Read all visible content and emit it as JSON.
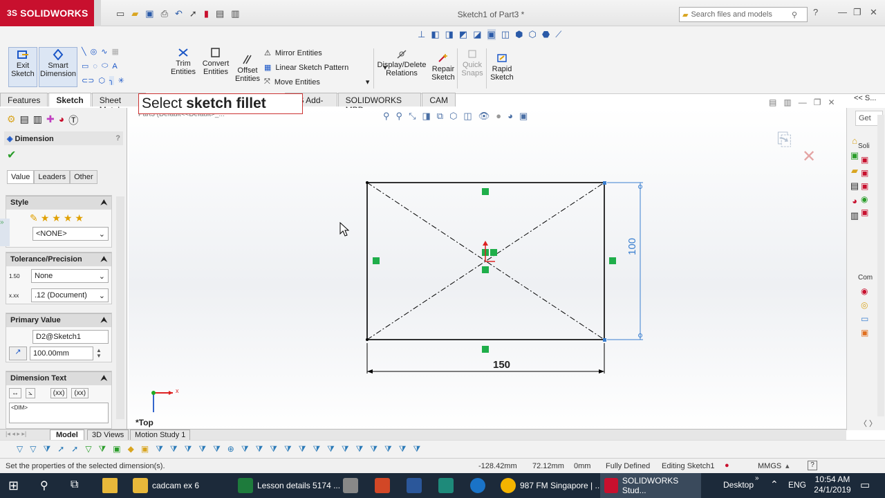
{
  "app": {
    "brand": "SOLIDWORKS",
    "brand_prefix": "3S",
    "document_title": "Sketch1 of Part3 *",
    "search_placeholder": "Search files and models"
  },
  "commands": {
    "exit_sketch": "Exit Sketch",
    "smart_dimension": "Smart Dimension",
    "trim_entities": "Trim Entities",
    "convert_entities": "Convert Entities",
    "offset_entities": "Offset Entities",
    "mirror_entities": "Mirror Entities",
    "linear_sketch_pattern": "Linear Sketch Pattern",
    "move_entities": "Move Entities",
    "display_delete_relations": "Display/Delete Relations",
    "repair_sketch": "Repair Sketch",
    "quick_snaps": "Quick Snaps",
    "rapid_sketch": "Rapid Sketch"
  },
  "tabs": [
    "Features",
    "Sketch",
    "Sheet Metal",
    "KS Add-Ins",
    "SOLIDWORKS MBD",
    "CAM"
  ],
  "active_tab": "Sketch",
  "tooltip": {
    "prefix": "Select ",
    "bold": "sketch fillet"
  },
  "tree_path": "Part3 (Default<<Default>_...",
  "property_manager": {
    "title": "Dimension",
    "help": "?",
    "subtabs": [
      "Value",
      "Leaders",
      "Other"
    ],
    "style": {
      "header": "Style",
      "selected": "<NONE>"
    },
    "tolerance": {
      "header": "Tolerance/Precision",
      "tolerance_value": "None",
      "precision_value": ".12 (Document)",
      "tol_icon_label": "1.50",
      "prec_icon_label": "x.xx"
    },
    "primary_value": {
      "header": "Primary Value",
      "name": "D2@Sketch1",
      "value": "100.00mm"
    },
    "dimension_text": {
      "header": "Dimension Text",
      "text": "<DIM>",
      "btn1": "(xx)",
      "btn2": "(xx)"
    }
  },
  "sketch": {
    "width_dimension": "150",
    "height_dimension": "100",
    "view_label": "*Top",
    "axis_x": "x",
    "axis_y": "y"
  },
  "right_panel": {
    "get": "Get",
    "sol": "Soli",
    "com": "Com",
    "header": "<< S..."
  },
  "bottom_tabs": [
    "Model",
    "3D Views",
    "Motion Study 1"
  ],
  "active_bottom_tab": "Model",
  "status": {
    "message": "Set the properties of the selected dimension(s).",
    "x": "-128.42mm",
    "y": "72.12mm",
    "z": "0mm",
    "state": "Fully Defined",
    "editing": "Editing Sketch1",
    "units": "MMGS"
  },
  "taskbar": {
    "items": [
      {
        "label": "cadcam ex 6",
        "color": "#e8b83a"
      },
      {
        "label": "Lesson details 5174 ...",
        "color": "#1e7b3c"
      },
      {
        "label": "",
        "color": "#888888"
      },
      {
        "label": "",
        "color": "#d24726"
      },
      {
        "label": "",
        "color": "#2b579a"
      },
      {
        "label": "",
        "color": "#1e8a7a"
      },
      {
        "label": "",
        "color": "#1a73c7"
      },
      {
        "label": "987 FM Singapore | ...",
        "color": "#f4b400"
      },
      {
        "label": "SOLIDWORKS Stud...",
        "color": "#c8102e"
      }
    ],
    "desktop": "Desktop",
    "lang": "ENG",
    "time": "10:54 AM",
    "date": "24/1/2019"
  },
  "colors": {
    "brand_red": "#c8102e",
    "dimension_blue": "#3a7fd0",
    "relation_green": "#1fae4a",
    "sketch_black": "#000000"
  }
}
